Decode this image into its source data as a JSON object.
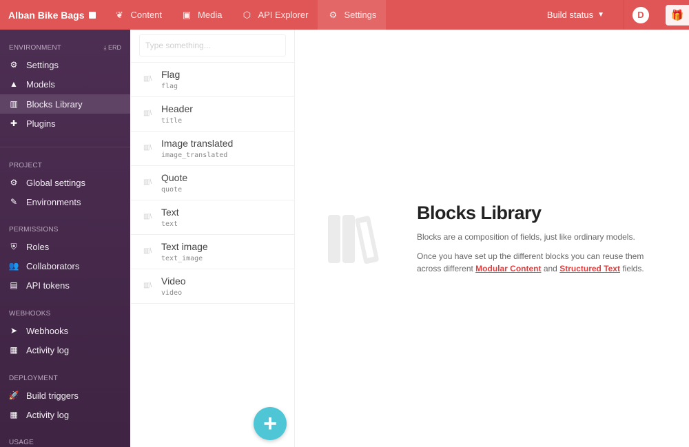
{
  "topbar": {
    "brand": "Alban Bike Bags",
    "tabs": [
      {
        "label": "Content",
        "icon": "leaf-icon"
      },
      {
        "label": "Media",
        "icon": "image-icon"
      },
      {
        "label": "API Explorer",
        "icon": "graphql-icon"
      },
      {
        "label": "Settings",
        "icon": "gear-icon",
        "active": true
      }
    ],
    "build_status": "Build status",
    "accent": "#e05656"
  },
  "sidebar": {
    "sections": [
      {
        "title": "ENVIRONMENT",
        "action": "ERD",
        "items": [
          {
            "label": "Settings"
          },
          {
            "label": "Models"
          },
          {
            "label": "Blocks Library",
            "active": true
          },
          {
            "label": "Plugins"
          }
        ]
      },
      {
        "title": "PROJECT",
        "items": [
          {
            "label": "Global settings"
          },
          {
            "label": "Environments"
          }
        ]
      },
      {
        "title": "PERMISSIONS",
        "items": [
          {
            "label": "Roles"
          },
          {
            "label": "Collaborators"
          },
          {
            "label": "API tokens"
          }
        ]
      },
      {
        "title": "WEBHOOKS",
        "items": [
          {
            "label": "Webhooks"
          },
          {
            "label": "Activity log"
          }
        ]
      },
      {
        "title": "DEPLOYMENT",
        "items": [
          {
            "label": "Build triggers"
          },
          {
            "label": "Activity log"
          }
        ]
      },
      {
        "title": "USAGE",
        "items": []
      }
    ]
  },
  "list": {
    "search_placeholder": "Type something...",
    "blocks": [
      {
        "name": "Flag",
        "api_key": "flag"
      },
      {
        "name": "Header",
        "api_key": "title"
      },
      {
        "name": "Image translated",
        "api_key": "image_translated"
      },
      {
        "name": "Quote",
        "api_key": "quote"
      },
      {
        "name": "Text",
        "api_key": "text"
      },
      {
        "name": "Text image",
        "api_key": "text_image"
      },
      {
        "name": "Video",
        "api_key": "video"
      }
    ]
  },
  "main": {
    "title": "Blocks Library",
    "p1": "Blocks are a composition of fields, just like ordinary models.",
    "p2_before": "Once you have set up the different blocks you can reuse them across different ",
    "link1": "Modular Content",
    "p2_mid": " and ",
    "link2": "Structured Text",
    "p2_after": " fields."
  }
}
